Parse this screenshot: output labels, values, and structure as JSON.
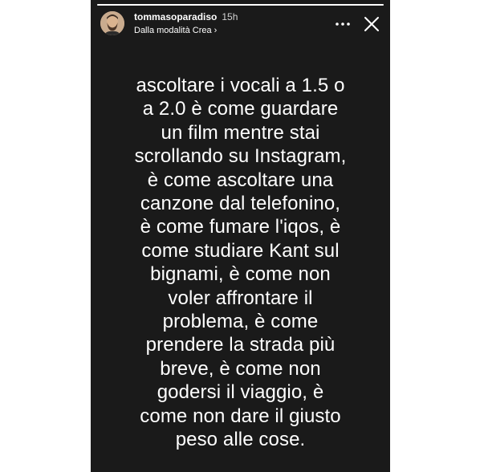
{
  "story": {
    "background": "#1a1a1a",
    "progress": 1.0,
    "user": {
      "username": "tommasoparadiso",
      "time": "15h",
      "subtitle": "Dalla modalità Crea",
      "subtitle_chevron": "›",
      "avatar_icon": "avatar-bearded-man"
    },
    "controls": {
      "more_icon": "more-horizontal-icon",
      "close_icon": "close-icon"
    },
    "text_lines": [
      "ascoltare i vocali a 1.5 o",
      "a 2.0 è come guardare",
      "un film mentre stai",
      "scrollando su Instagram,",
      "è come ascoltare una",
      "canzone dal telefonino,",
      "è come fumare l'iqos, è",
      "come studiare Kant sul",
      "bignami, è come non",
      "voler affrontare il",
      "problema, è come",
      "prendere la strada più",
      "breve, è come non",
      "godersi il viaggio, è",
      "come non dare il giusto",
      "peso alle cose."
    ]
  }
}
